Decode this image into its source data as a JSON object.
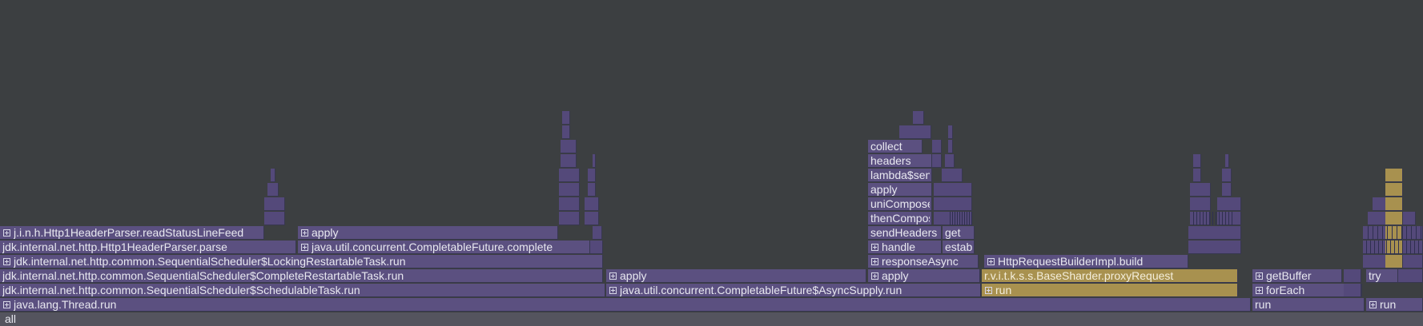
{
  "colors": {
    "background": "#3c3f41",
    "frame": "#5b5080",
    "frame_alt": "#54497a",
    "frame_dark": "#4a426e",
    "highlight": "#a8914f",
    "text": "#e8e8f0",
    "highlight_text": "#f4eedb",
    "root": "#54545e"
  },
  "root": {
    "label": "all"
  },
  "frames": [
    {
      "id": "thread-run",
      "label": "java.lang.Thread.run",
      "plus": true
    },
    {
      "id": "run-a",
      "label": "run"
    },
    {
      "id": "run-b",
      "label": "run",
      "plus": true
    },
    {
      "id": "schedulable-task-run",
      "label": "jdk.internal.net.http.common.SequentialScheduler$SchedulableTask.run"
    },
    {
      "id": "async-supply-run",
      "label": "java.util.concurrent.CompletableFuture$AsyncSupply.run",
      "plus": true
    },
    {
      "id": "run-hl",
      "label": "run",
      "plus": true,
      "hl": true
    },
    {
      "id": "foreach",
      "label": "forEach",
      "plus": true
    },
    {
      "id": "complete-restartable-run",
      "label": "jdk.internal.net.http.common.SequentialScheduler$CompleteRestartableTask.run"
    },
    {
      "id": "apply-a",
      "label": "apply",
      "plus": true
    },
    {
      "id": "apply-b",
      "label": "apply",
      "plus": true
    },
    {
      "id": "proxy-request",
      "label": "r.v.i.t.k.s.s.BaseSharder.proxyRequest",
      "hl": true
    },
    {
      "id": "get-buffer",
      "label": "getBuffer",
      "plus": true
    },
    {
      "id": "try",
      "label": "try"
    },
    {
      "id": "locking-restartable-run",
      "label": "jdk.internal.net.http.common.SequentialScheduler$LockingRestartableTask.run",
      "plus": true
    },
    {
      "id": "response-async",
      "label": "responseAsync",
      "plus": true
    },
    {
      "id": "request-build",
      "label": "HttpRequestBuilderImpl.build",
      "plus": true
    },
    {
      "id": "parser-parse",
      "label": "jdk.internal.net.http.Http1HeaderParser.parse"
    },
    {
      "id": "future-complete",
      "label": "java.util.concurrent.CompletableFuture.complete",
      "plus": true
    },
    {
      "id": "handle",
      "label": "handle",
      "plus": true
    },
    {
      "id": "estab",
      "label": "estab"
    },
    {
      "id": "read-status-line-feed",
      "label": "j.i.n.h.Http1HeaderParser.readStatusLineFeed",
      "plus": true
    },
    {
      "id": "apply-c",
      "label": "apply",
      "plus": true
    },
    {
      "id": "send-headers",
      "label": "sendHeaders"
    },
    {
      "id": "get",
      "label": "get"
    },
    {
      "id": "then-compose",
      "label": "thenCompose"
    },
    {
      "id": "uni-compose",
      "label": "uniCompose"
    },
    {
      "id": "apply-d",
      "label": "apply"
    },
    {
      "id": "lambda-send",
      "label": "lambda$send"
    },
    {
      "id": "headers",
      "label": "headers"
    },
    {
      "id": "collect",
      "label": "collect"
    }
  ]
}
